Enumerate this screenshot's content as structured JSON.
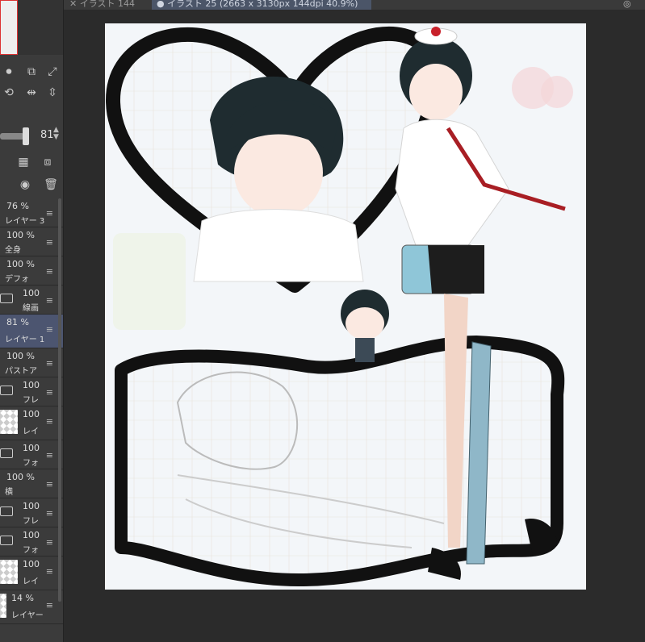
{
  "tabs": [
    {
      "label": "イラスト 144"
    },
    {
      "label": "イラスト 25 (2663 x 3130px 144dpi 40.9%)"
    }
  ],
  "tab_more": "◎",
  "opacity": {
    "value": "81"
  },
  "layers": [
    {
      "percent": "76 %",
      "name": "レイヤー 3"
    },
    {
      "percent": "100 %",
      "name": "全身"
    },
    {
      "percent": "100 %",
      "name": "デフォ"
    },
    {
      "percent": "100",
      "name": "線画"
    },
    {
      "percent": "81 %",
      "name": "レイヤー 1"
    },
    {
      "percent": "100 %",
      "name": "パストア"
    },
    {
      "percent": "100",
      "name": "フレ"
    },
    {
      "percent": "100",
      "name": "レイ"
    },
    {
      "percent": "100",
      "name": "フォ"
    },
    {
      "percent": "100 %",
      "name": "横"
    },
    {
      "percent": "100",
      "name": "フレ"
    },
    {
      "percent": "100",
      "name": "フォ"
    },
    {
      "percent": "100",
      "name": "レイ"
    },
    {
      "percent": "14 %",
      "name": "レイヤー"
    }
  ],
  "icons": [
    "record-icon",
    "resize-icon",
    "fit-icon",
    "rotate-icon",
    "flip-h-icon",
    "flip-v-icon",
    "mask-icon",
    "delete-icon"
  ]
}
